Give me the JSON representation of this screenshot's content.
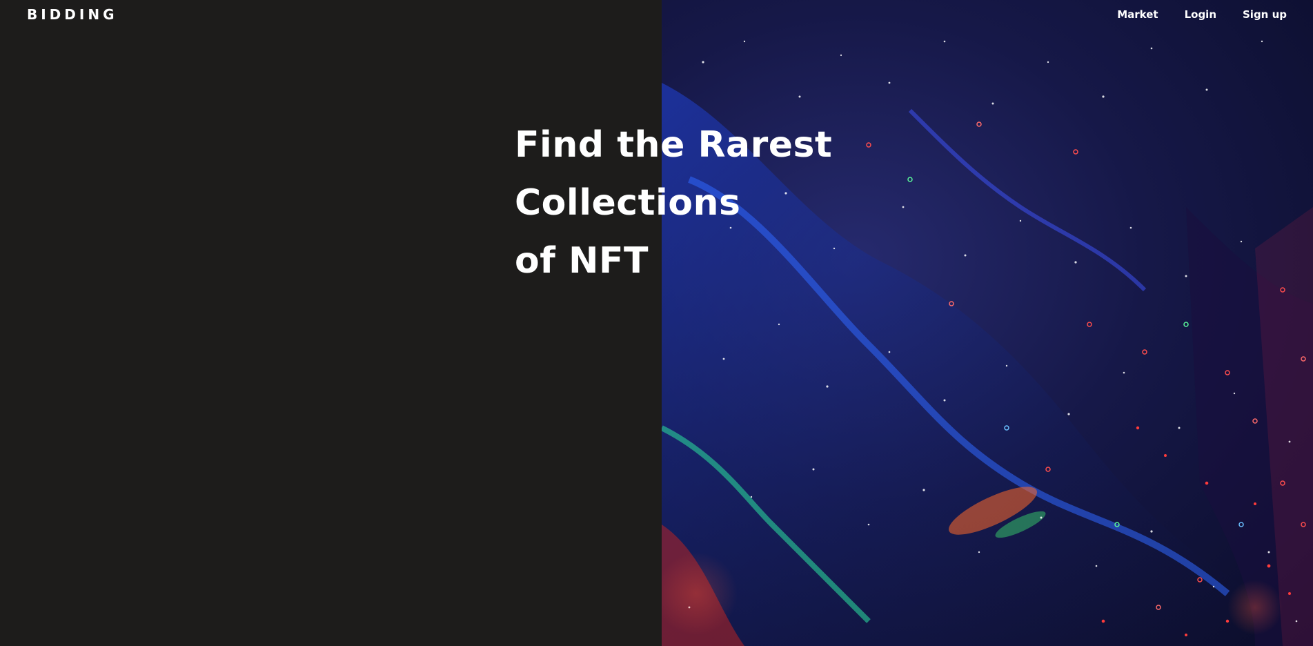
{
  "brand": {
    "logo_text": "BIDDING"
  },
  "nav": {
    "items": [
      {
        "label": "Market"
      },
      {
        "label": "Login"
      },
      {
        "label": "Sign up"
      }
    ]
  },
  "hero": {
    "headline_lines": [
      "Find the Rarest",
      "Collections",
      "of NFT"
    ],
    "left_panel_color": "#1d1c1b",
    "image_description_colors": [
      "#161848",
      "#2a63ff",
      "#ff3b3b",
      "#34e07a"
    ]
  }
}
